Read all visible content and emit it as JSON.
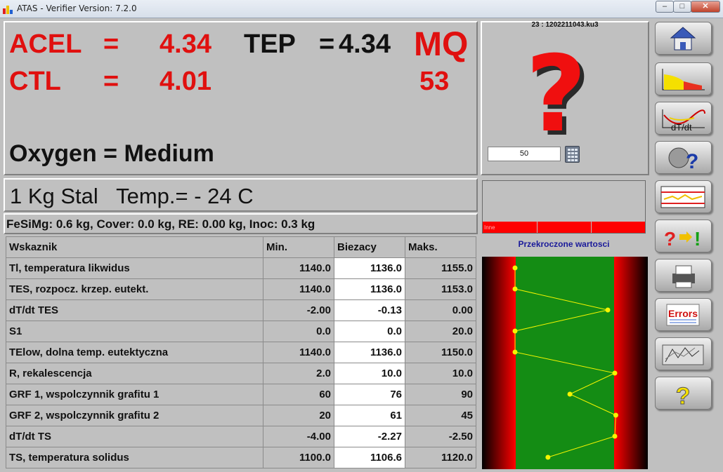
{
  "window": {
    "title": "ATAS - Verifier Version: 7.2.0"
  },
  "readouts": {
    "acel_label": "ACEL",
    "acel_eq": "=",
    "acel_value": "4.34",
    "tep_label": "TEP",
    "tep_eq": "=",
    "tep_value": "4.34",
    "ctl_label": "CTL",
    "ctl_eq": "=",
    "ctl_value": "4.01",
    "mq_label": "MQ",
    "mq_value": "53",
    "oxygen": "Oxygen = Medium"
  },
  "sample": {
    "desc": "1 Kg Stal   Temp.= - 24 C",
    "additions": "FeSiMg: 0.6 kg, Cover: 0.0 kg, RE: 0.00 kg, Inoc: 0.3 kg"
  },
  "table": {
    "headers": [
      "Wskaznik",
      "Min.",
      "Biezacy",
      "Maks."
    ],
    "rows": [
      [
        "Tl, temperatura likwidus",
        "1140.0",
        "1136.0",
        "1155.0"
      ],
      [
        "TES, rozpocz. krzep. eutekt.",
        "1140.0",
        "1136.0",
        "1153.0"
      ],
      [
        "dT/dt TES",
        "-2.00",
        "-0.13",
        "0.00"
      ],
      [
        "S1",
        "0.0",
        "0.0",
        "20.0"
      ],
      [
        "TElow, dolna temp. eutektyczna",
        "1140.0",
        "1136.0",
        "1150.0"
      ],
      [
        "R, rekalescencja",
        "2.0",
        "10.0",
        "10.0"
      ],
      [
        "GRF 1, wspolczynnik grafitu 1",
        "60",
        "76",
        "90"
      ],
      [
        "GRF 2, wspolczynnik grafitu 2",
        "20",
        "61",
        "45"
      ],
      [
        "dT/dt TS",
        "-4.00",
        "-2.27",
        "-2.50"
      ],
      [
        "TS, temperatura solidus",
        "1100.0",
        "1106.6",
        "1120.0"
      ]
    ]
  },
  "status": {
    "file": "23 : 1202211043.ku3",
    "question_icon": "question-mark-icon",
    "input_value": "50",
    "bar_label": "Inne",
    "exceeded_title": "Przekroczone wartosci",
    "point_positions": [
      0.0,
      0.0,
      0.93,
      0.0,
      0.0,
      1.0,
      0.55,
      1.01,
      1.0,
      0.33
    ]
  },
  "sidebar": {
    "buttons": [
      {
        "icon": "home-icon"
      },
      {
        "icon": "distribution-chart-icon"
      },
      {
        "icon": "dt-dt-curve-icon"
      },
      {
        "icon": "head-question-icon"
      },
      {
        "icon": "limits-chart-icon"
      },
      {
        "icon": "question-arrow-exclaim-icon"
      },
      {
        "icon": "printer-icon"
      },
      {
        "icon": "errors-icon",
        "label": "Errors"
      },
      {
        "icon": "archive-chart-icon"
      },
      {
        "icon": "help-icon"
      }
    ]
  },
  "colors": {
    "red": "#e0100f",
    "green": "#148c14",
    "panel": "#c0c0c0",
    "link_blue": "#1a1a9a"
  }
}
